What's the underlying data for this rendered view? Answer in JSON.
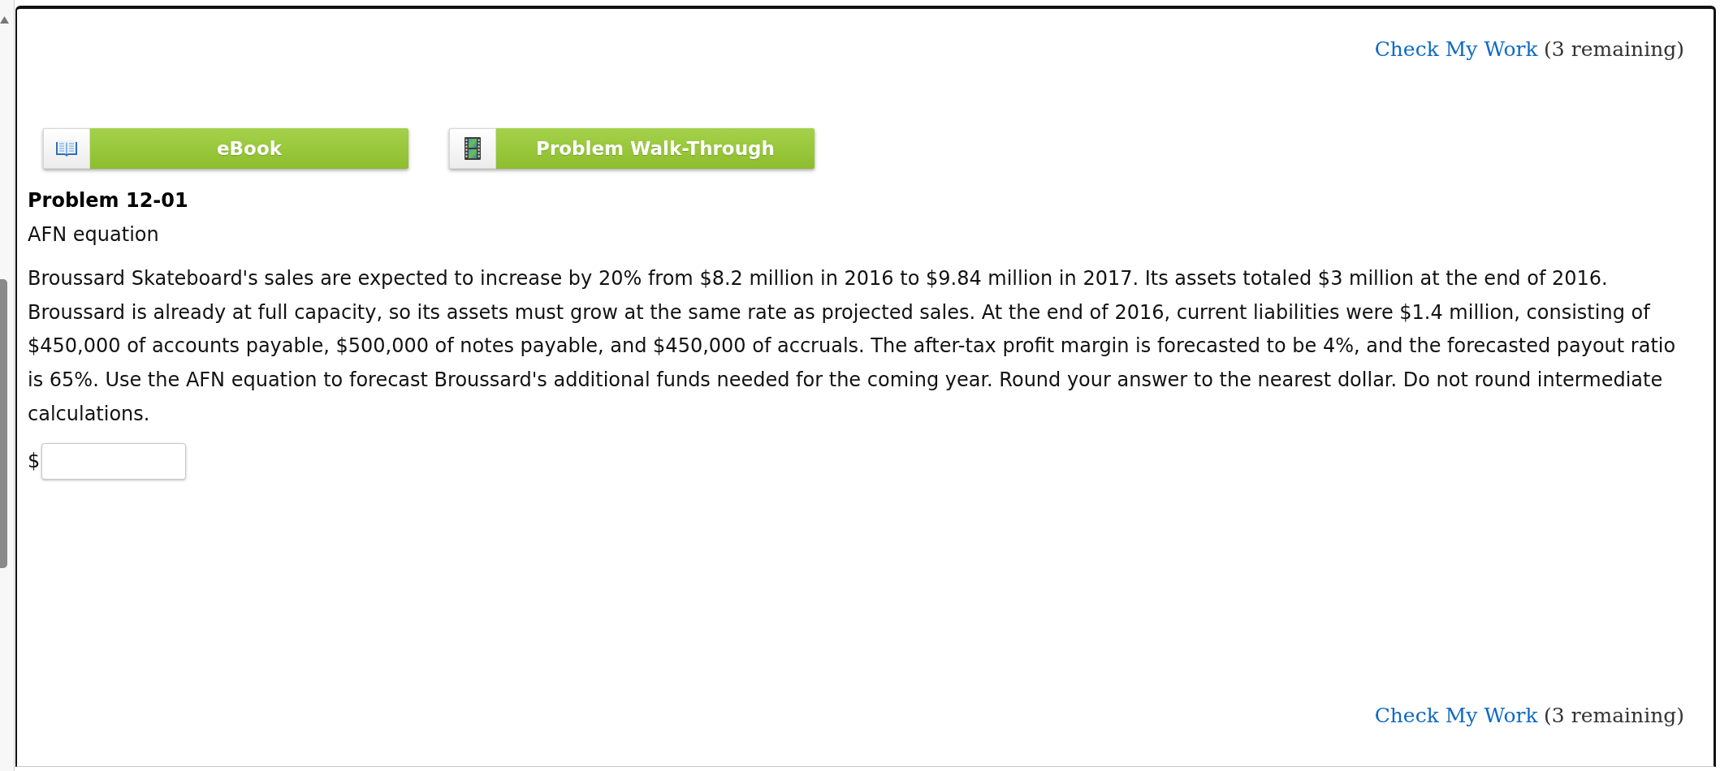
{
  "header_link": {
    "link": "Check My Work",
    "note": "(3 remaining)"
  },
  "resource_buttons": [
    {
      "label": "eBook",
      "kind": "ebook"
    },
    {
      "label": "Problem Walk-Through",
      "kind": "video"
    }
  ],
  "problem": {
    "title": "Problem 12-01",
    "subtitle": "AFN equation",
    "text": "Broussard Skateboard's sales are expected to increase by 20% from $8.2 million in 2016 to $9.84 million in 2017. Its assets totaled $3 million at the end of 2016. Broussard is already at full capacity, so its assets must grow at the same rate as projected sales. At the end of 2016, current liabilities were $1.4 million, consisting of $450,000 of accounts payable, $500,000 of notes payable, and $450,000 of accruals. The after-tax profit margin is forecasted to be 4%, and the forecasted payout ratio is 65%. Use the AFN equation to forecast Broussard's additional funds needed for the coming year. Round your answer to the nearest dollar. Do not round intermediate calculations.",
    "answer": {
      "unit": "$"
    }
  },
  "footer_link": {
    "link": "Check My Work",
    "note": "(3 remaining)"
  }
}
